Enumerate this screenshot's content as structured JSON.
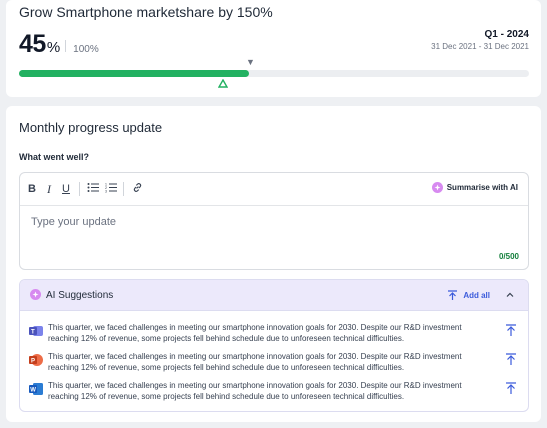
{
  "goal": {
    "title": "Grow Smartphone marketshare by 150%",
    "progress_value": "45",
    "progress_unit": "%",
    "target": "100%",
    "progress_fraction": 0.45,
    "quarter": "Q1 - 2024",
    "date_range": "31 Dec 2021 - 31 Dec 2021",
    "colors": {
      "progress": "#22b161",
      "track": "#eceef1"
    }
  },
  "update": {
    "section_title": "Monthly progress update",
    "question": "What went well?",
    "toolbar": {
      "bold_icon": "bold-icon",
      "italic_icon": "italic-icon",
      "underline_icon": "underline-icon",
      "bullet_list_icon": "bulleted-list-icon",
      "numbered_list_icon": "numbered-list-icon",
      "link_icon": "link-icon",
      "summarise_label": "Summarise with AI"
    },
    "editor_placeholder": "Type your update",
    "char_counter": "0/500"
  },
  "ai_suggestions": {
    "title": "AI Suggestions",
    "add_all_label": "Add all",
    "items": [
      {
        "app": "teams",
        "text": "This quarter, we faced challenges in meeting our smartphone innovation goals for 2030. Despite our R&D investment reaching 12% of revenue, some projects fell behind schedule due to unforeseen technical difficulties."
      },
      {
        "app": "powerpoint",
        "text": "This quarter, we faced challenges in meeting our smartphone innovation goals for 2030. Despite our R&D investment reaching 12% of revenue, some projects fell behind schedule due to unforeseen technical difficulties."
      },
      {
        "app": "word",
        "text": "This quarter, we faced challenges in meeting our smartphone innovation goals for 2030. Despite our R&D investment reaching 12% of revenue, some projects fell behind schedule due to unforeseen technical difficulties."
      }
    ]
  }
}
